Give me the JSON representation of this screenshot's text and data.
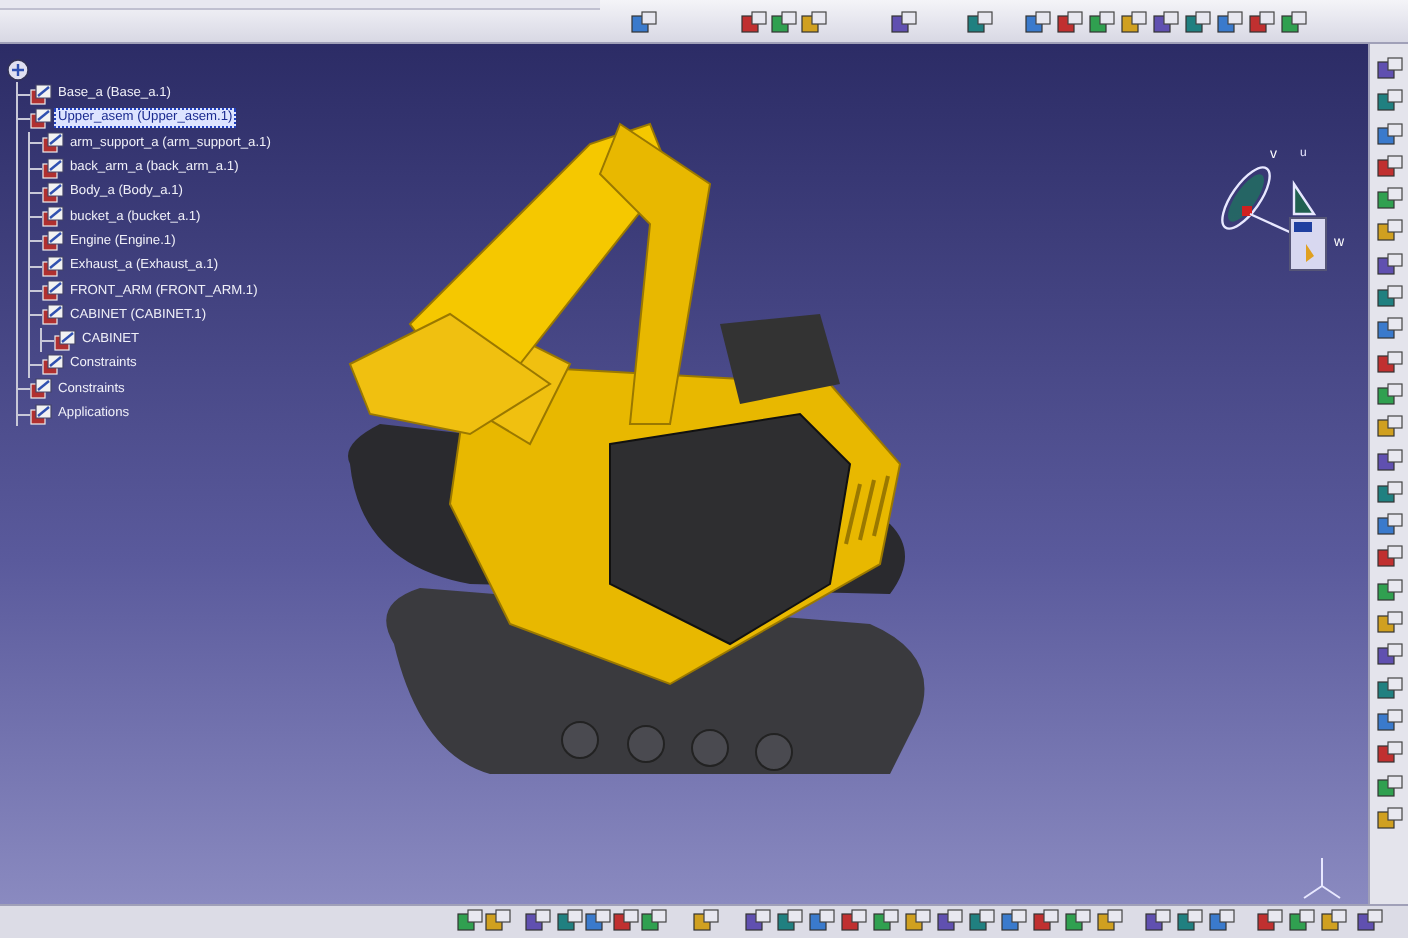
{
  "tree": {
    "children": [
      {
        "label": "Base_a (Base_a.1)",
        "selected": false
      },
      {
        "label": "Upper_asem (Upper_asem.1)",
        "selected": true,
        "children": [
          {
            "label": "arm_support_a (arm_support_a.1)",
            "selected": false
          },
          {
            "label": "back_arm_a (back_arm_a.1)",
            "selected": false
          },
          {
            "label": "Body_a (Body_a.1)",
            "selected": false
          },
          {
            "label": "bucket_a (bucket_a.1)",
            "selected": false
          },
          {
            "label": "Engine (Engine.1)",
            "selected": false
          },
          {
            "label": "Exhaust_a (Exhaust_a.1)",
            "selected": false
          },
          {
            "label": "FRONT_ARM (FRONT_ARM.1)",
            "selected": false
          },
          {
            "label": "CABINET (CABINET.1)",
            "selected": false,
            "children": [
              {
                "label": "CABINET",
                "selected": false
              }
            ]
          },
          {
            "label": "Constraints",
            "selected": false
          }
        ]
      },
      {
        "label": "Constraints",
        "selected": false
      },
      {
        "label": "Applications",
        "selected": false
      }
    ]
  },
  "compass": {
    "axes": [
      "v",
      "u",
      "w"
    ]
  }
}
